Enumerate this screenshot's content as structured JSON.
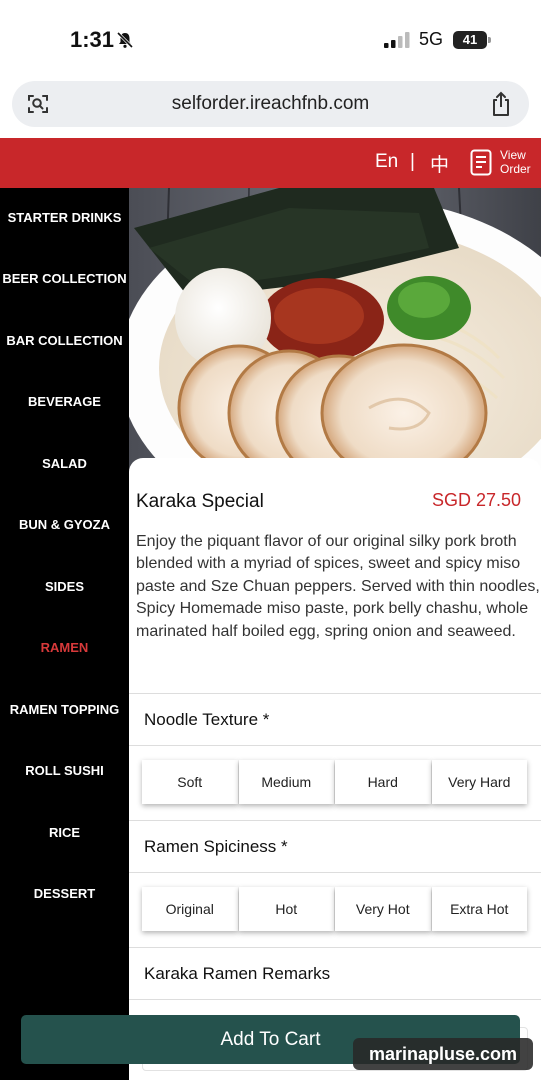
{
  "status_bar": {
    "time": "1:31",
    "network": "5G",
    "battery": "41"
  },
  "browser": {
    "url": "selforder.ireachfnb.com"
  },
  "header": {
    "lang_en": "En",
    "lang_separator": "|",
    "lang_zh": "中",
    "view_order": "View Order",
    "color": "#c8272a"
  },
  "sidebar": {
    "items": [
      {
        "label": "STARTER DRINKS"
      },
      {
        "label": "BEER COLLECTION"
      },
      {
        "label": "BAR COLLECTION"
      },
      {
        "label": "BEVERAGE"
      },
      {
        "label": "SALAD"
      },
      {
        "label": "BUN & GYOZA"
      },
      {
        "label": "SIDES"
      },
      {
        "label": "RAMEN",
        "active": true
      },
      {
        "label": "RAMEN TOPPING"
      },
      {
        "label": "ROLL SUSHI"
      },
      {
        "label": "RICE"
      },
      {
        "label": "DESSERT"
      }
    ],
    "active_color": "#d8393a"
  },
  "item": {
    "name": "Karaka Special",
    "price": "SGD 27.50",
    "description": "Enjoy the piquant flavor of our original silky pork broth blended with a myriad of spices, sweet and spicy miso paste and Sze Chuan peppers. Served with thin noodles, Spicy Homemade miso paste, pork belly chashu, whole marinated half boiled egg, spring onion and seaweed."
  },
  "options": {
    "noodle_texture": {
      "title": "Noodle Texture *",
      "choices": [
        "Soft",
        "Medium",
        "Hard",
        "Very Hard"
      ]
    },
    "spiciness": {
      "title": "Ramen Spiciness *",
      "choices": [
        "Original",
        "Hot",
        "Very Hot",
        "Extra Hot"
      ]
    },
    "remarks": {
      "title": "Karaka Ramen Remarks"
    }
  },
  "cart": {
    "label": "Add To Cart",
    "color": "#25524d"
  },
  "watermark": "marinapluse.com",
  "icons": [
    "bell-off-icon",
    "signal-icon",
    "battery-icon",
    "camera-search-icon",
    "share-icon",
    "order-list-icon"
  ]
}
